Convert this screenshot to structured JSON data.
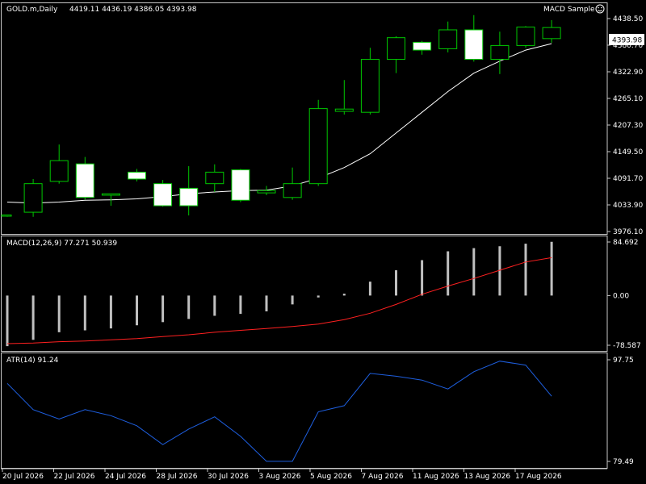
{
  "colors": {
    "background": "#000000",
    "frame": "#c8c8c8",
    "bull": "#00c800",
    "bear_fill": "#ffffff",
    "ma": "#ffffff",
    "macd_hist": "#c0c0c0",
    "macd_signal": "#ff2020",
    "atr": "#1e5fe0",
    "text": "#ffffff"
  },
  "header": {
    "symbol_info": "GOLD.m,Daily",
    "ohlc": "4419.11 4436.19 4386.05 4393.98",
    "expert": "MACD Sample",
    "expert_icon": "smiley-face-icon"
  },
  "price_label": "4393.98",
  "macd_label": "MACD(12,26,9) 77.271 50.939",
  "atr_label": "ATR(14) 91.24",
  "chart_data": [
    {
      "type": "candlestick",
      "name": "price",
      "y_ticks": [
        "4438.50",
        "4380.70",
        "4322.90",
        "4265.10",
        "4207.30",
        "4149.50",
        "4091.70",
        "4033.90",
        "3976.10"
      ],
      "ylim": [
        3976.1,
        4438.5
      ],
      "candles": [
        {
          "o": 4010,
          "h": 4012,
          "l": 4008,
          "c": 4012
        },
        {
          "o": 4018,
          "h": 4090,
          "l": 4008,
          "c": 4080
        },
        {
          "o": 4085,
          "h": 4165,
          "l": 4080,
          "c": 4130
        },
        {
          "o": 4123,
          "h": 4138,
          "l": 4045,
          "c": 4050
        },
        {
          "o": 4055,
          "h": 4058,
          "l": 4032,
          "c": 4058
        },
        {
          "o": 4105,
          "h": 4112,
          "l": 4085,
          "c": 4090
        },
        {
          "o": 4080,
          "h": 4088,
          "l": 4030,
          "c": 4032
        },
        {
          "o": 4070,
          "h": 4118,
          "l": 4011,
          "c": 4032
        },
        {
          "o": 4080,
          "h": 4122,
          "l": 4062,
          "c": 4105
        },
        {
          "o": 4110,
          "h": 4112,
          "l": 4040,
          "c": 4044
        },
        {
          "o": 4060,
          "h": 4075,
          "l": 4055,
          "c": 4065
        },
        {
          "o": 4050,
          "h": 4115,
          "l": 4045,
          "c": 4080
        },
        {
          "o": 4080,
          "h": 4262,
          "l": 4075,
          "c": 4243
        },
        {
          "o": 4237,
          "h": 4305,
          "l": 4230,
          "c": 4242
        },
        {
          "o": 4235,
          "h": 4375,
          "l": 4230,
          "c": 4350
        },
        {
          "o": 4350,
          "h": 4400,
          "l": 4320,
          "c": 4397
        },
        {
          "o": 4387,
          "h": 4390,
          "l": 4360,
          "c": 4370
        },
        {
          "o": 4373,
          "h": 4432,
          "l": 4365,
          "c": 4414
        },
        {
          "o": 4414,
          "h": 4446,
          "l": 4345,
          "c": 4350
        },
        {
          "o": 4350,
          "h": 4410,
          "l": 4318,
          "c": 4380
        },
        {
          "o": 4380,
          "h": 4422,
          "l": 4375,
          "c": 4420
        },
        {
          "o": 4395,
          "h": 4435,
          "l": 4386,
          "c": 4419
        }
      ],
      "ma": [
        4040,
        4038,
        4040,
        4044,
        4045,
        4047,
        4052,
        4058,
        4062,
        4065,
        4066,
        4075,
        4092,
        4115,
        4145,
        4190,
        4235,
        4280,
        4320,
        4346,
        4370,
        4384
      ]
    },
    {
      "type": "bar",
      "name": "MACD(12,26,9)",
      "y_ticks": [
        "84.692",
        "0.00",
        "-78.587"
      ],
      "ylim": [
        -78.587,
        84.692
      ],
      "histogram": [
        -80,
        -70,
        -58,
        -55,
        -52,
        -47,
        -42,
        -37,
        -32,
        -29,
        -25,
        -14,
        -3,
        3,
        22,
        40,
        56,
        70,
        75,
        78,
        82,
        85
      ],
      "signal": [
        -76,
        -75,
        -73,
        -72,
        -70,
        -68,
        -65,
        -62,
        -58,
        -55,
        -52,
        -49,
        -45,
        -38,
        -28,
        -14,
        2,
        15,
        27,
        40,
        53,
        60
      ]
    },
    {
      "type": "line",
      "name": "ATR(14)",
      "y_ticks": [
        "97.75",
        "79.49"
      ],
      "ylim": [
        79.49,
        97.75
      ],
      "values": [
        93.5,
        88.8,
        87.1,
        88.8,
        87.7,
        85.9,
        82.5,
        85.3,
        87.5,
        84.0,
        79.5,
        79.5,
        88.4,
        89.5,
        95.3,
        94.8,
        94.1,
        92.5,
        95.6,
        97.5,
        96.8,
        91.2
      ]
    }
  ],
  "x_labels": [
    "20 Jul 2026",
    "22 Jul 2026",
    "24 Jul 2026",
    "28 Jul 2026",
    "30 Jul 2026",
    "3 Aug 2026",
    "5 Aug 2026",
    "7 Aug 2026",
    "11 Aug 2026",
    "13 Aug 2026",
    "17 Aug 2026"
  ]
}
